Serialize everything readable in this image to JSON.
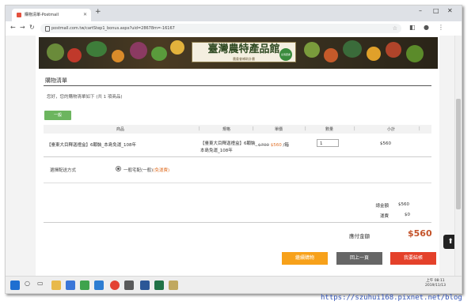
{
  "browser": {
    "tab_title": "購物清單-Postmall",
    "new_tab": "+",
    "url": "postmall.com.tw/cartStep1_bonus.aspx?uid=28678m=-16167",
    "window_controls": [
      "–",
      "□",
      "✕"
    ]
  },
  "banner": {
    "title": "臺灣農特產品館",
    "subtitle": "農委會補助計畫",
    "seal": "台灣農產"
  },
  "cart": {
    "heading": "購物清單",
    "greeting": "您好，您的購物清單如下 (共 1 項商品)",
    "group_button": "一般",
    "columns": [
      "商品",
      "規格",
      "單價",
      "數量",
      "小計"
    ],
    "item": {
      "name": "【臺東大目釋迦禮盒】6顆裝_本島免運_108年",
      "spec": "【臺東大目釋迦禮盒】6顆裝_本島免運_108年",
      "old_price": "$700",
      "price": "$560",
      "unit": "/箱",
      "quantity": "1",
      "subtotal": "$560"
    },
    "shipping": {
      "label": "選擇配送方式",
      "option": "一般宅配(一般)",
      "note": "(免運費)"
    },
    "summary": {
      "total_label": "總金額",
      "total_value": "$560",
      "shipping_label": "運費",
      "shipping_value": "$0",
      "payable_label": "應付金額",
      "payable_value": "$560"
    },
    "buttons": {
      "continue": "繼續購物",
      "back": "回上一頁",
      "checkout": "我要結帳"
    }
  },
  "taskbar": {
    "clock_time": "上午 08:11",
    "clock_date": "2019/11/13"
  },
  "watermark": "https://szuhui168.pixnet.net/blog",
  "colors": {
    "accent_orange": "#f7a11a",
    "checkout_red": "#e4412a",
    "back_gray": "#666666",
    "group_green": "#6cb55f",
    "price_orange": "#e0722a",
    "total_red": "#c4532a"
  }
}
